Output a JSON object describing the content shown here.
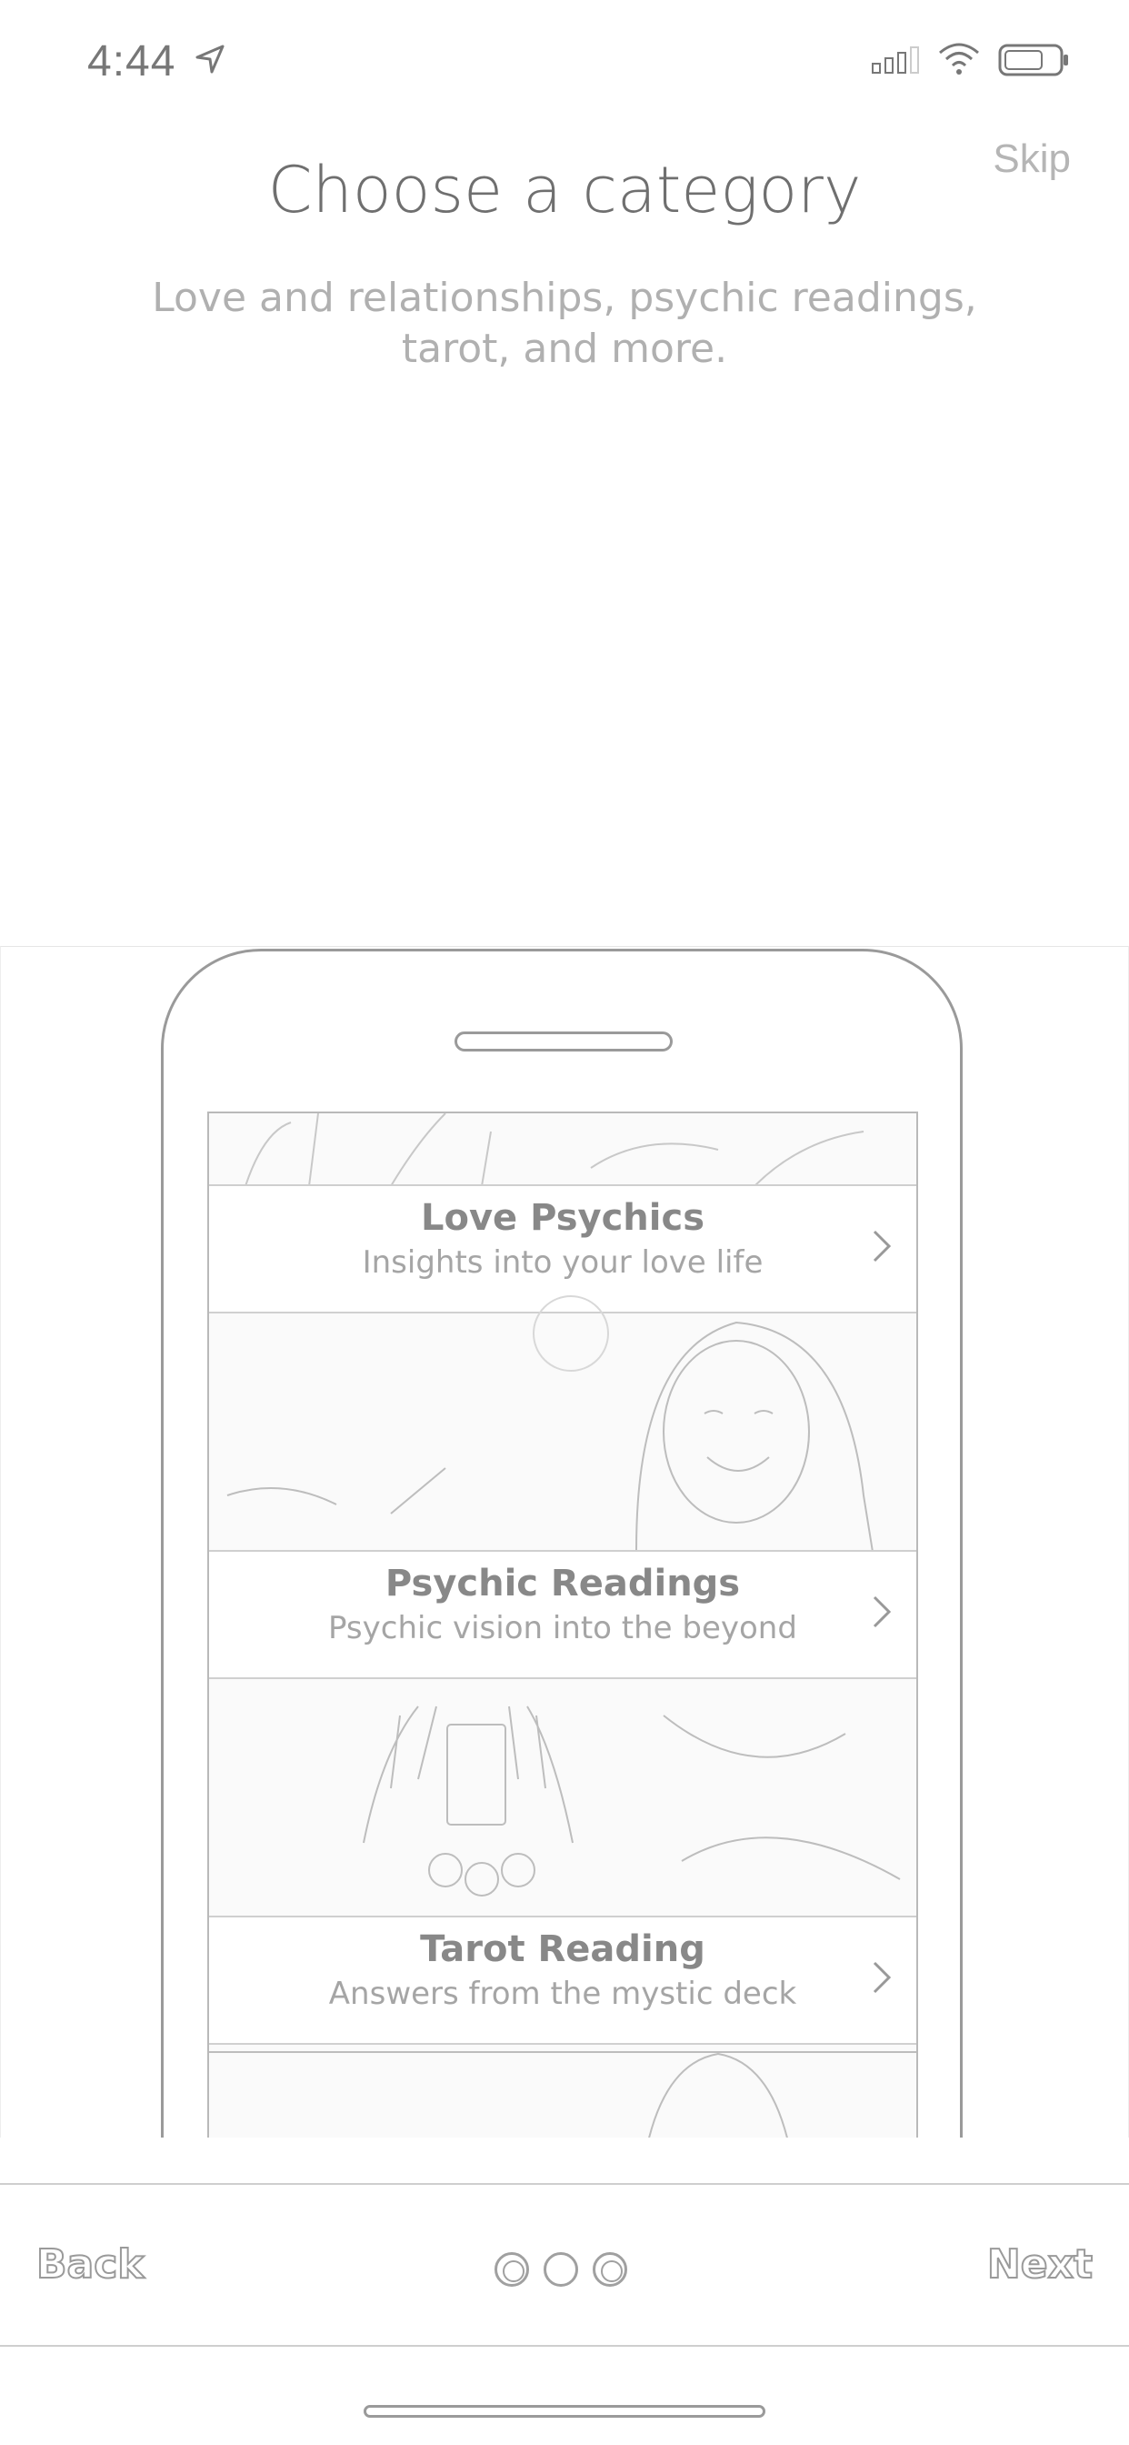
{
  "status_bar": {
    "time": "4:44"
  },
  "header": {
    "skip_label": "Skip",
    "title": "Choose a category",
    "subtitle": "Love and relationships, psychic readings, tarot, and more."
  },
  "categories": [
    {
      "title": "Love Psychics",
      "subtitle": "Insights into your love life"
    },
    {
      "title": "Psychic Readings",
      "subtitle": "Psychic vision into the beyond"
    },
    {
      "title": "Tarot Reading",
      "subtitle": "Answers from the mystic deck"
    }
  ],
  "nav": {
    "back_label": "Back",
    "next_label": "Next",
    "page_count": 3,
    "current_page": 1
  },
  "colors": {
    "line": "#9a9a9a",
    "text_muted": "#b0b0b0"
  }
}
